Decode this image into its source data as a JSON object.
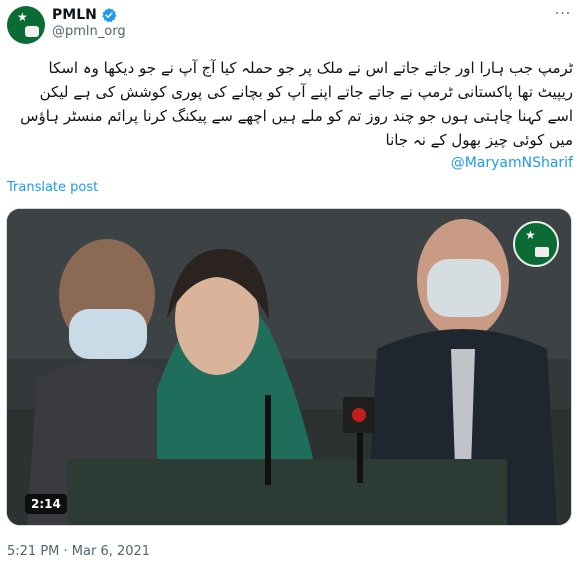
{
  "post": {
    "display_name": "PMLN",
    "handle": "@pmln_org",
    "verified_icon": "verified-badge-icon",
    "more_icon": "more-options-icon",
    "more_label": "···",
    "text_lines": [
      "ٹرمپ جب ہارا اور جاتے جاتے اس نے ملک پر جو حملہ کیا آج آپ نے جو دیکھا وہ اسکا",
      "ریپیٹ تھا پاکستانی ٹرمپ نے جاتے جاتے اپنے آپ کو بچانے کی پوری کوشش کی ہے لیکن",
      "اسے کہنا چاہتی ہوں جو چند روز تم کو ملے ہیں اچھے سے پیکنگ کرنا پرائم منسٹر ہاؤس",
      "میں کوئی چیز بھول کے نہ جانا"
    ],
    "mention": "@MaryamNSharif",
    "translate_label": "Translate post",
    "video": {
      "duration": "2:14",
      "logo": "pmln-logo-icon"
    },
    "timestamp": "5:21 PM · Mar 6, 2021"
  },
  "colors": {
    "link": "#1d9bf0",
    "text": "#0f1419",
    "muted": "#536471",
    "brand_green": "#0b6b35"
  }
}
